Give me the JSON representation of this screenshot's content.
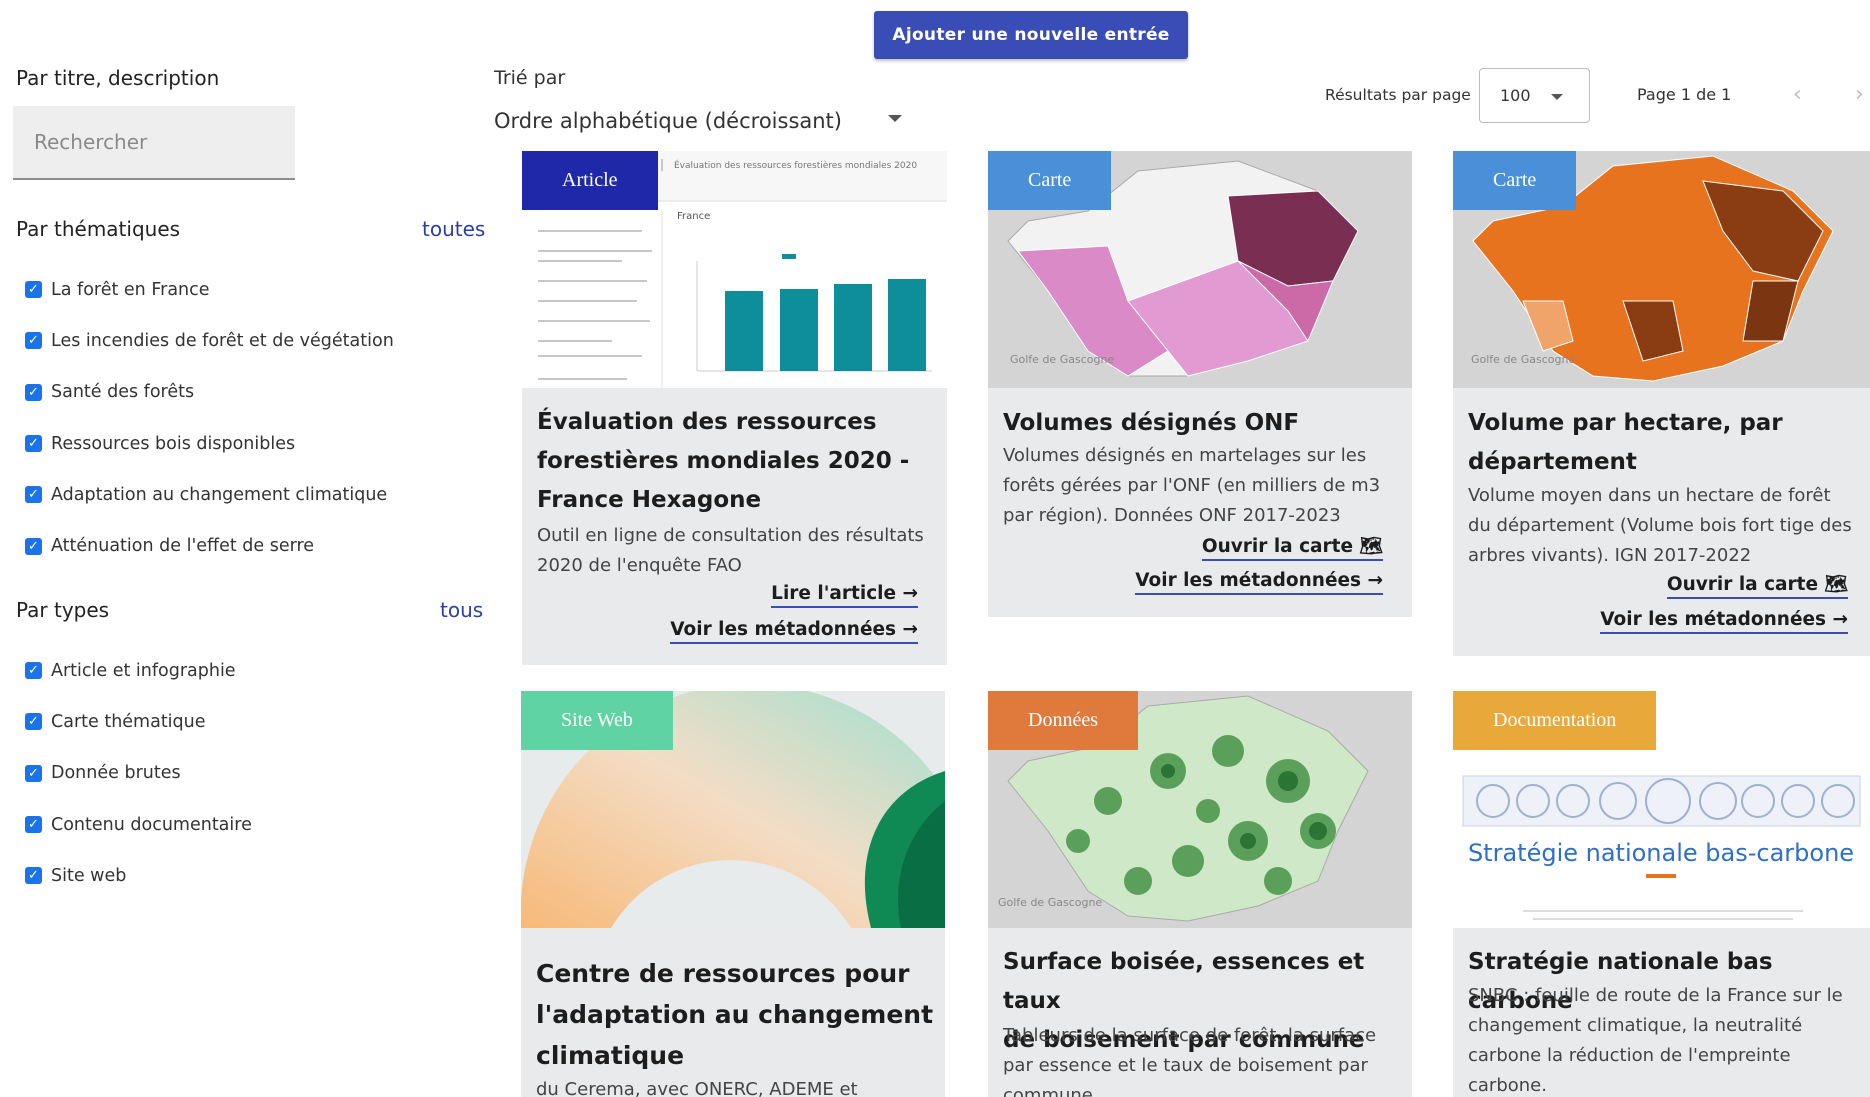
{
  "toolbar": {
    "add_entry_label": "Ajouter une nouvelle entrée",
    "sort_label": "Trié par",
    "sort_value": "Ordre alphabétique (décroissant)",
    "results_per_page_label": "Résultats par page",
    "results_per_page_value": "100",
    "page_info": "Page 1 de 1",
    "prev_icon": "chevron-left-icon",
    "next_icon": "chevron-right-icon"
  },
  "sidebar": {
    "search_label": "Par titre, description",
    "search_placeholder": "Rechercher",
    "search_value": "",
    "themes_title": "Par thématiques",
    "themes_all": "toutes",
    "themes": [
      {
        "label": "La forêt en France",
        "checked": true
      },
      {
        "label": "Les incendies de forêt et de végétation",
        "checked": true
      },
      {
        "label": "Santé des forêts",
        "checked": true
      },
      {
        "label": "Ressources bois disponibles",
        "checked": true
      },
      {
        "label": "Adaptation au changement climatique",
        "checked": true
      },
      {
        "label": "Atténuation de l'effet de serre",
        "checked": true
      }
    ],
    "types_title": "Par types",
    "types_all": "tous",
    "types": [
      {
        "label": "Article et infographie",
        "checked": true
      },
      {
        "label": "Carte thématique",
        "checked": true
      },
      {
        "label": "Donnée brutes",
        "checked": true
      },
      {
        "label": "Contenu documentaire",
        "checked": true
      },
      {
        "label": "Site web",
        "checked": true
      }
    ]
  },
  "cards": [
    {
      "badge": "Article",
      "badge_color": "#1f28a8",
      "title_lines": [
        "Évaluation des ressources",
        "forestières mondiales 2020 -",
        "France Hexagone"
      ],
      "desc_lines": [
        "Outil en ligne de consultation des résultats",
        "2020 de l'enquête FAO"
      ],
      "links": [
        "Lire l'article →",
        "Voir les métadonnées →"
      ],
      "thumb_header": "Évaluation des ressources forestières mondiales 2020",
      "thumb_country": "France"
    },
    {
      "badge": "Carte",
      "badge_color": "#4a90d9",
      "title_lines": [
        "Volumes désignés ONF"
      ],
      "desc_lines": [
        "Volumes désignés en martelages sur les",
        "forêts gérées par l'ONF (en milliers de m3",
        "par région). Données ONF 2017-2023"
      ],
      "links": [
        "Ouvrir la carte 🗺",
        "Voir les métadonnées →"
      ],
      "map_label": "Golfe de Gascogne"
    },
    {
      "badge": "Carte",
      "badge_color": "#4a90d9",
      "title_lines": [
        "Volume par hectare, par",
        "département"
      ],
      "desc_lines": [
        "Volume moyen dans un hectare de forêt",
        "du département (Volume bois fort tige des",
        "arbres vivants). IGN 2017-2022"
      ],
      "links": [
        "Ouvrir la carte 🗺",
        "Voir les métadonnées →"
      ],
      "map_label": "Golfe de Gascogne"
    },
    {
      "badge": "Site Web",
      "badge_color": "#5fd3a4",
      "title_lines": [
        "Centre de ressources pour",
        "l'adaptation au changement",
        "climatique"
      ],
      "desc_lines": [
        "du Cerema, avec ONERC, ADEME et"
      ],
      "links": []
    },
    {
      "badge": "Données",
      "badge_color": "#e07a3c",
      "title_lines": [
        "Surface boisée, essences et taux",
        "de boisement par commune"
      ],
      "desc_lines": [
        "Tableurs de la surface de forêt, la surface",
        "par essence et le taux de boisement par",
        "commune"
      ],
      "links": [],
      "map_label": "Golfe de Gascogne"
    },
    {
      "badge": "Documentation",
      "badge_color": "#e8a93a",
      "title_lines": [
        "Stratégie nationale bas carbone"
      ],
      "desc_lines": [
        "SNBC : feuille de route de la France sur le",
        "changement climatique, la neutralité",
        "carbone la réduction de l'empreinte",
        "carbone."
      ],
      "links": [],
      "thumb_title": "Stratégie nationale bas-carbone"
    }
  ]
}
